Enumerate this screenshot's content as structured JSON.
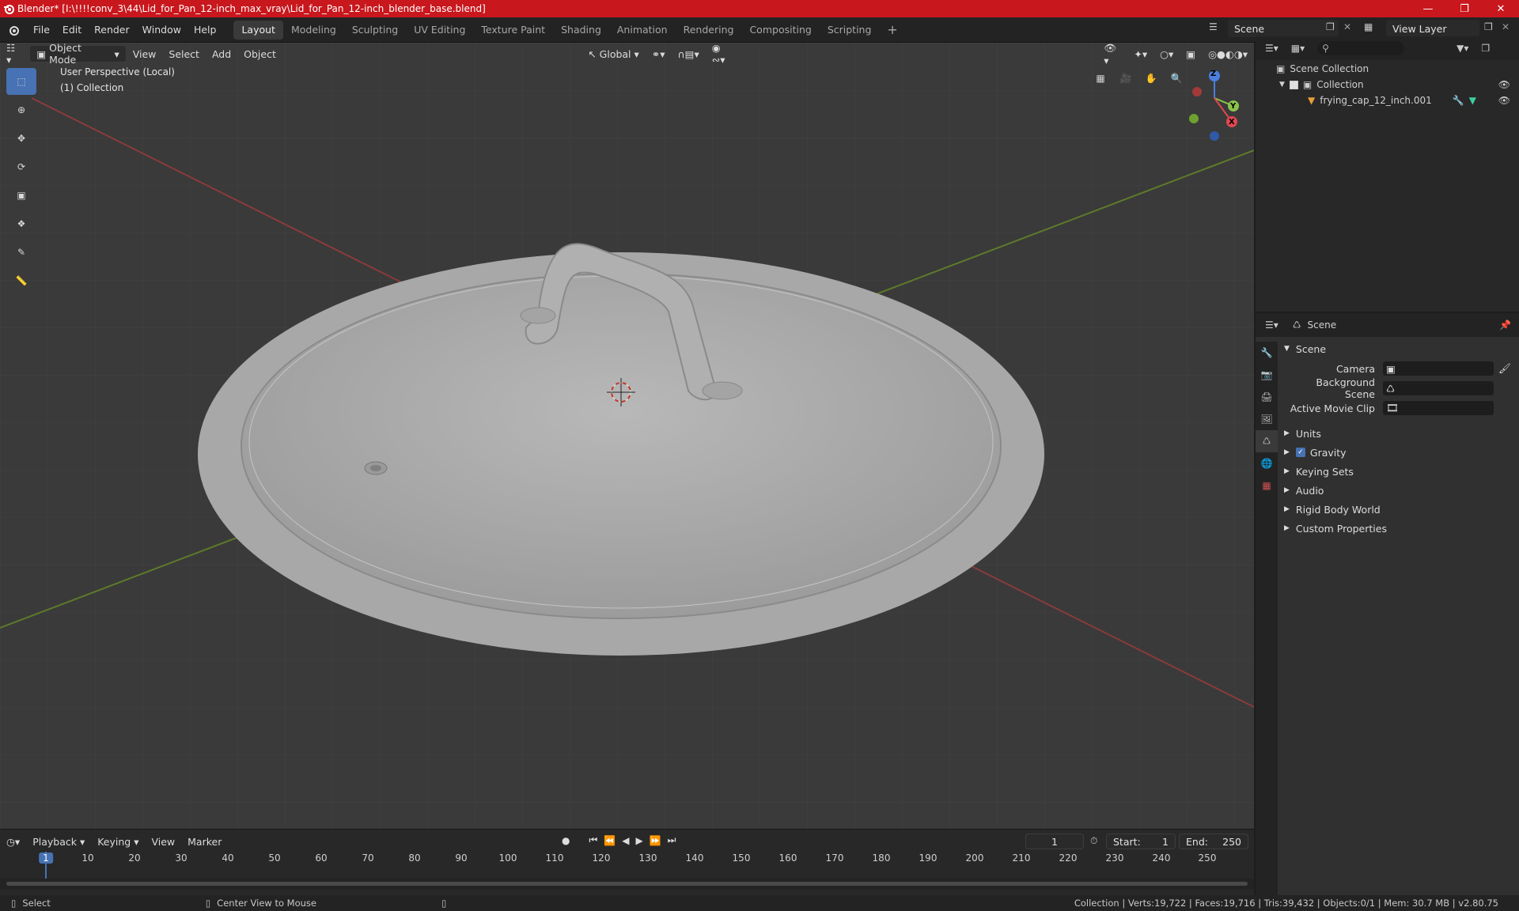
{
  "window": {
    "title": "Blender* [I:\\!!!!conv_3\\44\\Lid_for_Pan_12-inch_max_vray\\Lid_for_Pan_12-inch_blender_base.blend]"
  },
  "menu": [
    "File",
    "Edit",
    "Render",
    "Window",
    "Help"
  ],
  "workspaces": [
    "Layout",
    "Modeling",
    "Sculpting",
    "UV Editing",
    "Texture Paint",
    "Shading",
    "Animation",
    "Rendering",
    "Compositing",
    "Scripting"
  ],
  "active_workspace": "Layout",
  "scene_name": "Scene",
  "view_layer": "View Layer",
  "viewport": {
    "mode": "Object Mode",
    "menus": [
      "View",
      "Select",
      "Add",
      "Object"
    ],
    "transform_orientation": "Global",
    "perspective_label": "User Perspective (Local)",
    "collection_label": "(1) Collection",
    "gizmo": {
      "x": "X",
      "y": "Y",
      "z": "Z"
    }
  },
  "outliner": {
    "root": "Scene Collection",
    "collection": "Collection",
    "object": "frying_cap_12_inch.001"
  },
  "properties": {
    "header": "Scene",
    "panel": "Scene",
    "fields": [
      {
        "label": "Camera",
        "value": ""
      },
      {
        "label": "Background Scene",
        "value": ""
      },
      {
        "label": "Active Movie Clip",
        "value": ""
      }
    ],
    "sections": [
      "Units",
      "Gravity",
      "Keying Sets",
      "Audio",
      "Rigid Body World",
      "Custom Properties"
    ],
    "gravity_checked": true
  },
  "timeline": {
    "menus": [
      "Playback",
      "Keying",
      "View",
      "Marker"
    ],
    "current_frame": "1",
    "start_label": "Start:",
    "start": "1",
    "end_label": "End:",
    "end": "250",
    "ticks": [
      "1",
      "10",
      "20",
      "30",
      "40",
      "50",
      "60",
      "70",
      "80",
      "90",
      "100",
      "110",
      "120",
      "130",
      "140",
      "150",
      "160",
      "170",
      "180",
      "190",
      "200",
      "210",
      "220",
      "230",
      "240",
      "250"
    ]
  },
  "status": {
    "left_action": "Select",
    "middle_action": "Center View to Mouse",
    "stats": "Collection | Verts:19,722 | Faces:19,716 | Tris:39,432 | Objects:0/1 | Mem: 30.7 MB | v2.80.75"
  }
}
